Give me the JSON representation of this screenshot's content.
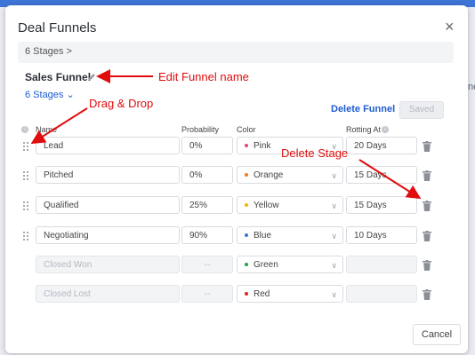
{
  "modal": {
    "title": "Deal Funnels",
    "close": "×",
    "section_bar": "6 Stages  >"
  },
  "funnel": {
    "name": "Sales Funnel",
    "stages_link": "6 Stages ⌄",
    "delete_label": "Delete Funnel",
    "saved_label": "Saved"
  },
  "columns": {
    "name": "Name",
    "probability": "Probability",
    "color": "Color",
    "rotting": "Rotting At"
  },
  "stages": [
    {
      "name": "Lead",
      "probability": "0%",
      "color": "Pink",
      "color_hex": "#e8428a",
      "rotting": "20 Days",
      "disabled": false
    },
    {
      "name": "Pitched",
      "probability": "0%",
      "color": "Orange",
      "color_hex": "#f07d1e",
      "rotting": "15 Days",
      "disabled": false
    },
    {
      "name": "Qualified",
      "probability": "25%",
      "color": "Yellow",
      "color_hex": "#f2b705",
      "rotting": "15 Days",
      "disabled": false
    },
    {
      "name": "Negotiating",
      "probability": "90%",
      "color": "Blue",
      "color_hex": "#3d74d6",
      "rotting": "10 Days",
      "disabled": false
    },
    {
      "name": "Closed Won",
      "probability": "--",
      "color": "Green",
      "color_hex": "#24a148",
      "rotting": "",
      "disabled": true
    },
    {
      "name": "Closed Lost",
      "probability": "--",
      "color": "Red",
      "color_hex": "#e02424",
      "rotting": "",
      "disabled": true
    }
  ],
  "footer": {
    "cancel_label": "Cancel"
  },
  "annotations": {
    "edit_funnel": "Edit Funnel name",
    "drag_drop": "Drag & Drop",
    "delete_stage": "Delete Stage"
  },
  "background": {
    "right_edge_text": "ne"
  },
  "colors": {
    "accent": "#1e5bd1",
    "annotation": "#e10d0d",
    "top_bar": "#3d74d6"
  }
}
